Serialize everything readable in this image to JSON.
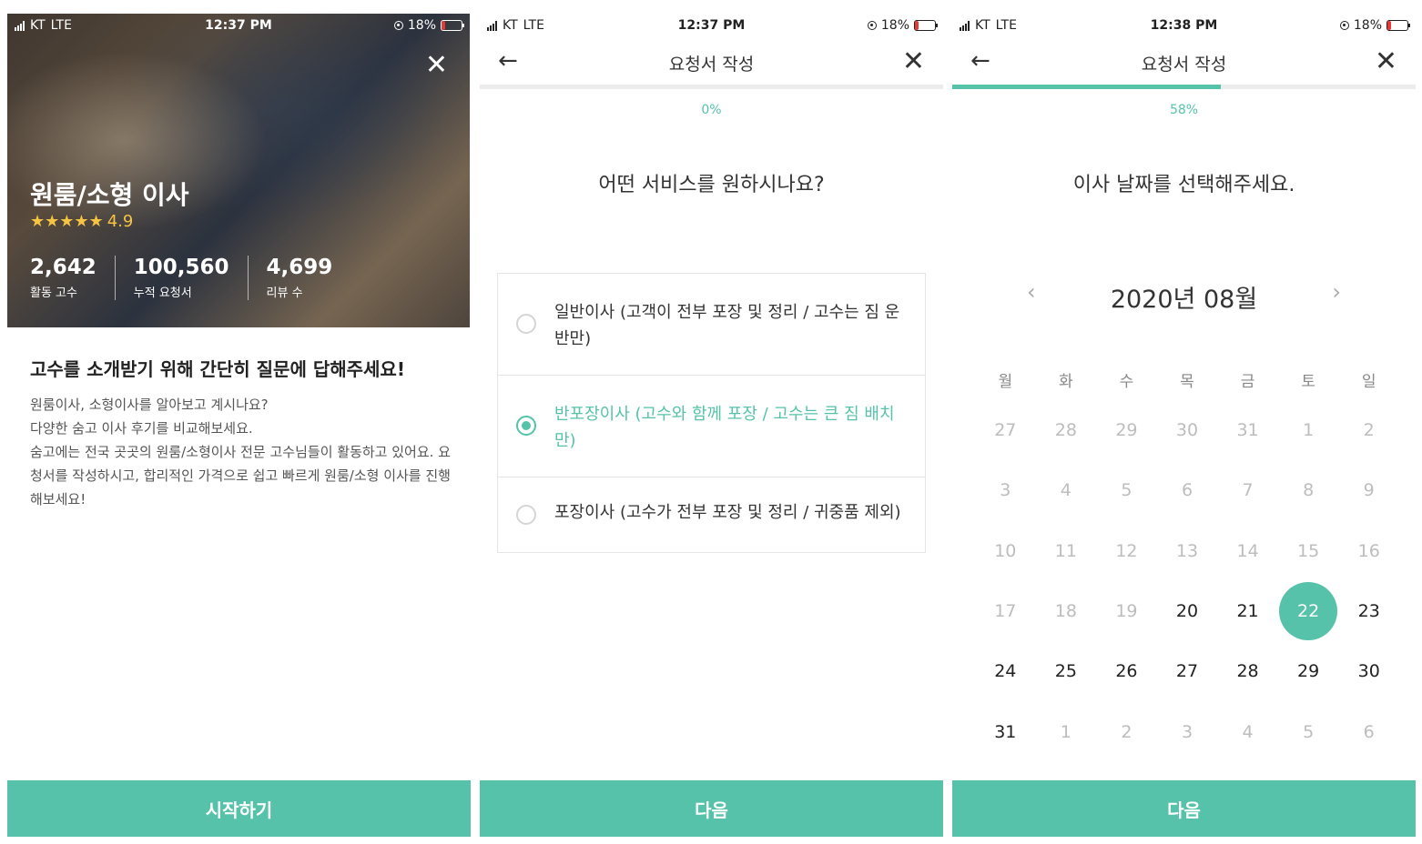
{
  "screen1": {
    "status": {
      "carrier": "KT",
      "network": "LTE",
      "time": "12:37 PM",
      "battery": "18%"
    },
    "category_title": "원룸/소형 이사",
    "stars": "★★★★★",
    "rating": "4.9",
    "stats": [
      {
        "value": "2,642",
        "label": "활동 고수"
      },
      {
        "value": "100,560",
        "label": "누적 요청서"
      },
      {
        "value": "4,699",
        "label": "리뷰 수"
      }
    ],
    "intro_heading": "고수를 소개받기 위해 간단히 질문에 답해주세요!",
    "intro_lines": [
      "원룸이사, 소형이사를 알아보고 계시나요?",
      "다양한 숨고 이사 후기를 비교해보세요.",
      "숨고에는 전국 곳곳의 원룸/소형이사 전문 고수님들이 활동하고 있어요. 요청서를 작성하시고, 합리적인 가격으로 쉽고 빠르게 원룸/소형 이사를 진행해보세요!"
    ],
    "cta": "시작하기"
  },
  "screen2": {
    "status": {
      "carrier": "KT",
      "network": "LTE",
      "time": "12:37 PM",
      "battery": "18%"
    },
    "nav_title": "요청서 작성",
    "progress_text": "0%",
    "progress_fraction": 0,
    "question": "어떤 서비스를 원하시나요?",
    "options": [
      {
        "label": "일반이사 (고객이 전부 포장 및 정리 / 고수는 짐 운반만)",
        "selected": false
      },
      {
        "label": "반포장이사 (고수와 함께 포장 / 고수는 큰 짐 배치만)",
        "selected": true
      },
      {
        "label": "포장이사 (고수가 전부 포장 및 정리 / 귀중품 제외)",
        "selected": false
      }
    ],
    "cta": "다음"
  },
  "screen3": {
    "status": {
      "carrier": "KT",
      "network": "LTE",
      "time": "12:38 PM",
      "battery": "18%"
    },
    "nav_title": "요청서 작성",
    "progress_text": "58%",
    "progress_fraction": 0.58,
    "question": "이사 날짜를 선택해주세요.",
    "month_label": "2020년 08월",
    "weekdays": [
      "월",
      "화",
      "수",
      "목",
      "금",
      "토",
      "일"
    ],
    "days": [
      {
        "d": "27",
        "s": "off"
      },
      {
        "d": "28",
        "s": "off"
      },
      {
        "d": "29",
        "s": "off"
      },
      {
        "d": "30",
        "s": "off"
      },
      {
        "d": "31",
        "s": "off"
      },
      {
        "d": "1",
        "s": "off"
      },
      {
        "d": "2",
        "s": "off"
      },
      {
        "d": "3",
        "s": "off"
      },
      {
        "d": "4",
        "s": "off"
      },
      {
        "d": "5",
        "s": "off"
      },
      {
        "d": "6",
        "s": "off"
      },
      {
        "d": "7",
        "s": "off"
      },
      {
        "d": "8",
        "s": "off"
      },
      {
        "d": "9",
        "s": "off"
      },
      {
        "d": "10",
        "s": "off"
      },
      {
        "d": "11",
        "s": "off"
      },
      {
        "d": "12",
        "s": "off"
      },
      {
        "d": "13",
        "s": "off"
      },
      {
        "d": "14",
        "s": "off"
      },
      {
        "d": "15",
        "s": "off"
      },
      {
        "d": "16",
        "s": "off"
      },
      {
        "d": "17",
        "s": "off"
      },
      {
        "d": "18",
        "s": "off"
      },
      {
        "d": "19",
        "s": "off"
      },
      {
        "d": "20",
        "s": "on"
      },
      {
        "d": "21",
        "s": "on"
      },
      {
        "d": "22",
        "s": "sel"
      },
      {
        "d": "23",
        "s": "on"
      },
      {
        "d": "24",
        "s": "on"
      },
      {
        "d": "25",
        "s": "on"
      },
      {
        "d": "26",
        "s": "on"
      },
      {
        "d": "27",
        "s": "on"
      },
      {
        "d": "28",
        "s": "on"
      },
      {
        "d": "29",
        "s": "on"
      },
      {
        "d": "30",
        "s": "on"
      },
      {
        "d": "31",
        "s": "on"
      },
      {
        "d": "1",
        "s": "off"
      },
      {
        "d": "2",
        "s": "off"
      },
      {
        "d": "3",
        "s": "off"
      },
      {
        "d": "4",
        "s": "off"
      },
      {
        "d": "5",
        "s": "off"
      },
      {
        "d": "6",
        "s": "off"
      }
    ],
    "cta": "다음"
  },
  "colors": {
    "accent": "#56c2aa",
    "star": "#f6c343",
    "battery_low": "#e53935"
  },
  "icons": {
    "back": "arrow-left-icon",
    "close": "close-icon",
    "prev": "chevron-left-icon",
    "next": "chevron-right-icon",
    "star": "star-icon"
  }
}
